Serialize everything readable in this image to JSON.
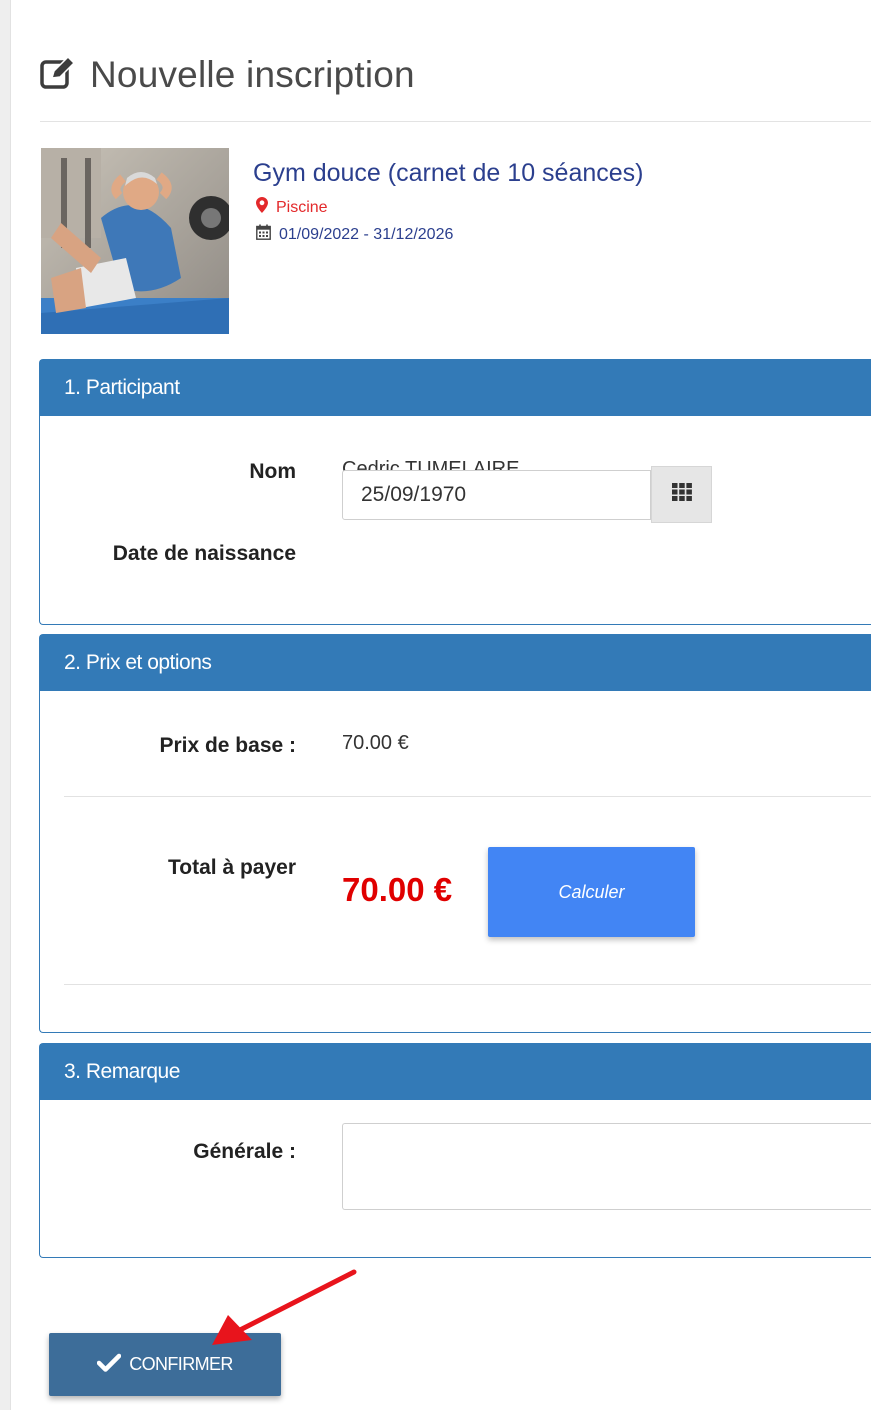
{
  "header": {
    "title": "Nouvelle inscription",
    "icon": "edit-icon"
  },
  "activity": {
    "title": "Gym douce (carnet de 10 séances)",
    "location": "Piscine",
    "dates": "01/09/2022 - 31/12/2026",
    "location_color": "#e3292b"
  },
  "participant": {
    "heading": "1. Participant",
    "name_label": "Nom",
    "name_value": "Cedric TUMELAIRE",
    "birth_label": "Date de naissance",
    "birth_value": "25/09/1970"
  },
  "pricing": {
    "heading": "2. Prix et options",
    "base_label": "Prix de base :",
    "base_value": "70.00 €",
    "total_label": "Total à payer",
    "total_value": "70.00 €",
    "calc_label": "Calculer"
  },
  "remark": {
    "heading": "3. Remarque",
    "general_label": "Générale :",
    "general_value": ""
  },
  "confirm": {
    "label": "CONFIRMER"
  },
  "colors": {
    "panel_blue": "#337ab7",
    "calc_blue": "#4285f4",
    "confirm_blue": "#3d6d99",
    "total_red": "#e00000",
    "annotation_arrow": "#e8141c"
  }
}
